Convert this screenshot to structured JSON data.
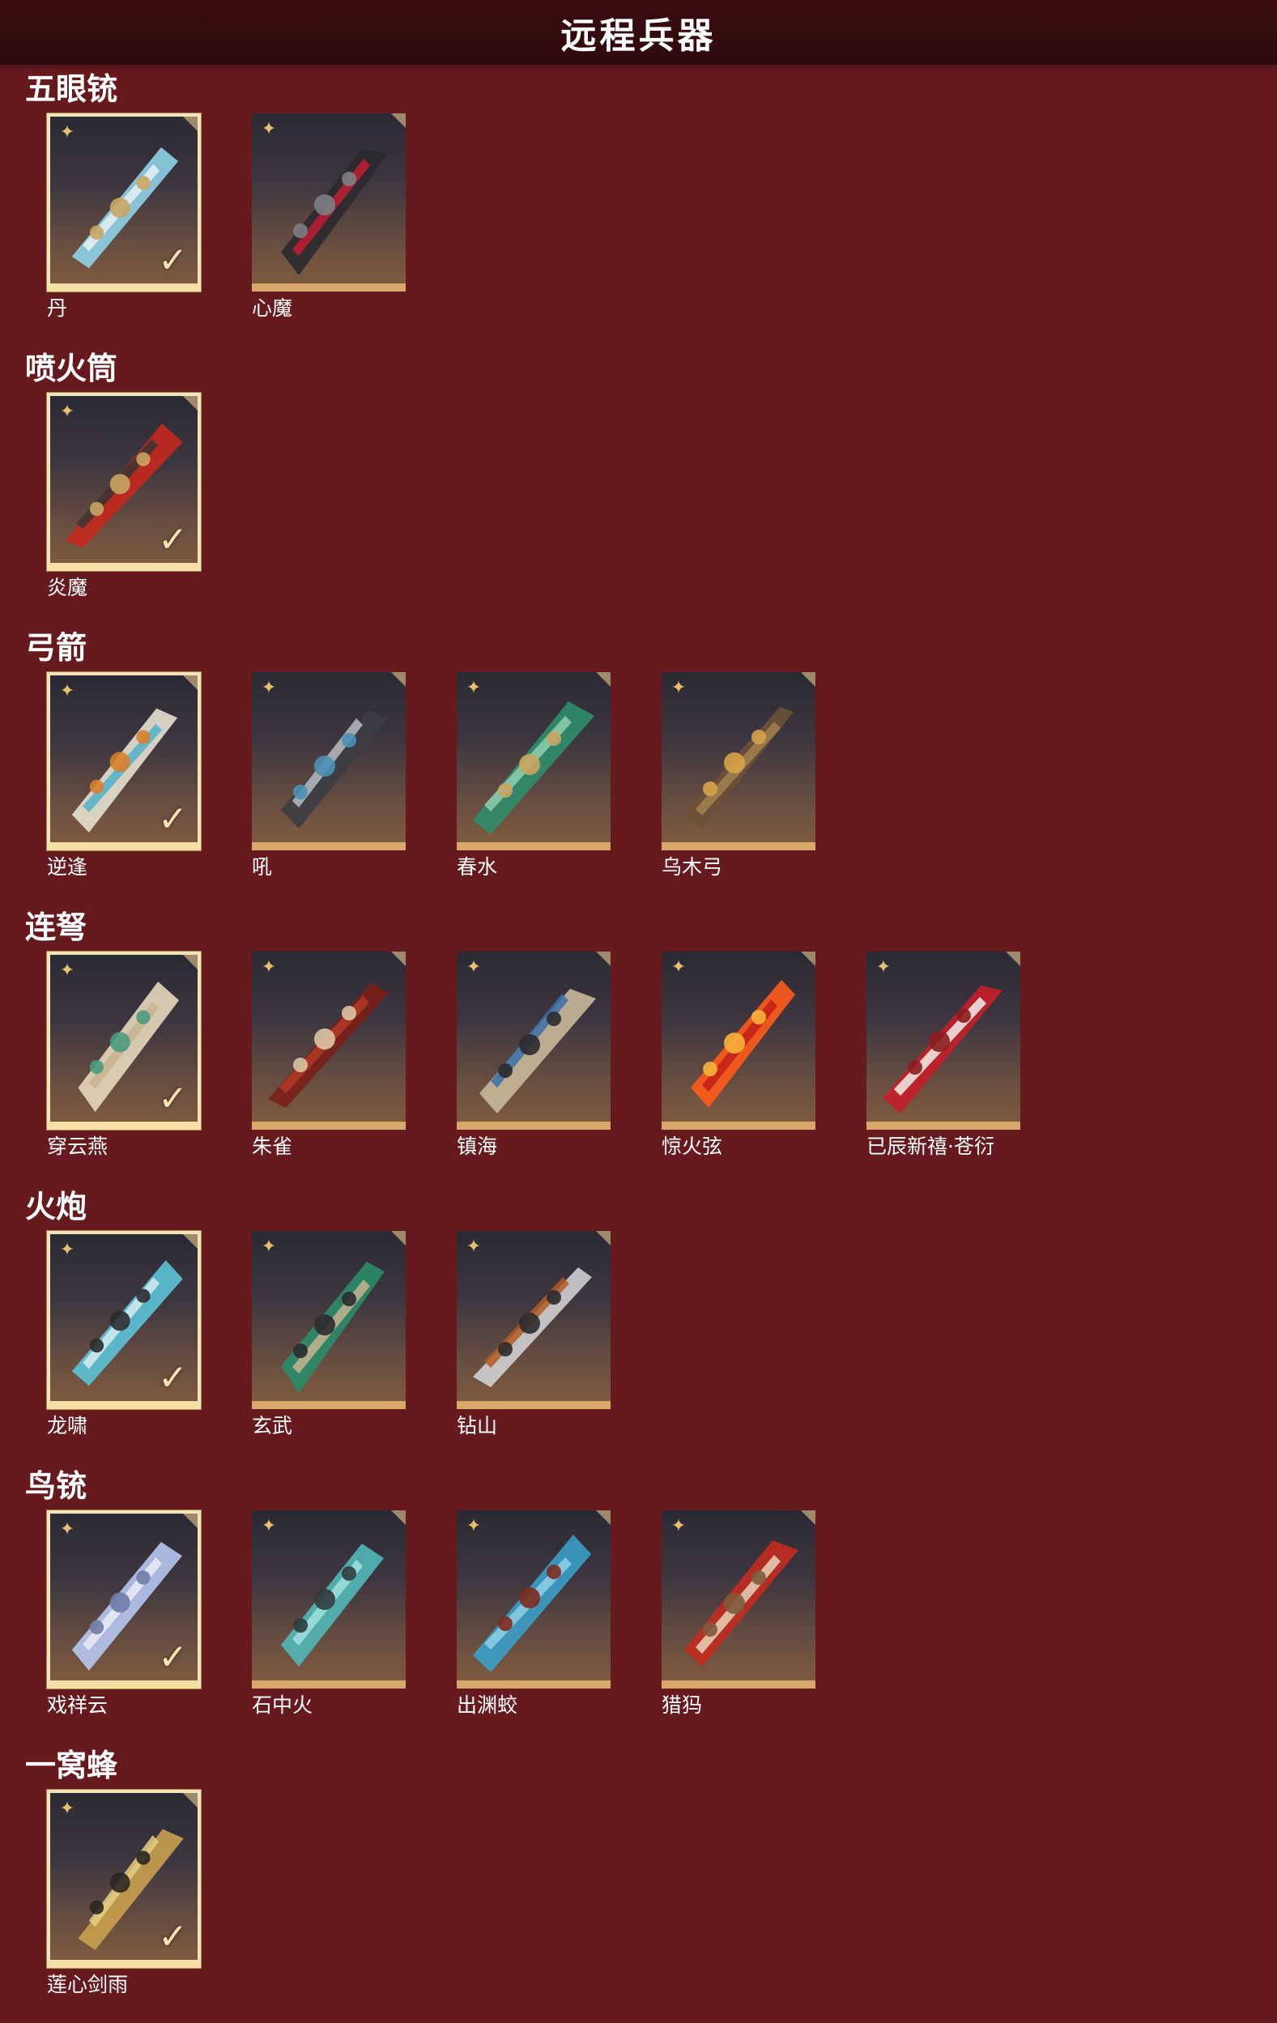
{
  "title": "远程兵器",
  "colors": {
    "background": "#671a1e",
    "header": "#2e0a0c",
    "owned_border": "#f3e3b8",
    "card_bottom": "#d8a86a"
  },
  "sections": [
    {
      "title": "五眼铳",
      "items": [
        {
          "label": "丹",
          "owned": true,
          "palette": [
            "#8fd1e8",
            "#e6f1f3",
            "#c9a562"
          ]
        },
        {
          "label": "心魔",
          "owned": false,
          "palette": [
            "#2a2a2e",
            "#c21d34",
            "#7b7f85"
          ]
        }
      ]
    },
    {
      "title": "喷火筒",
      "items": [
        {
          "label": "炎魔",
          "owned": true,
          "palette": [
            "#c4281e",
            "#3a3532",
            "#c9a562"
          ]
        }
      ]
    },
    {
      "title": "弓箭",
      "items": [
        {
          "label": "逆逢",
          "owned": true,
          "palette": [
            "#e6e1d0",
            "#4fb2c9",
            "#d97f2b"
          ]
        },
        {
          "label": "吼",
          "owned": false,
          "palette": [
            "#3c3d42",
            "#b9bcc2",
            "#4d8fb5"
          ]
        },
        {
          "label": "春水",
          "owned": false,
          "palette": [
            "#2f8d6b",
            "#8ecfae",
            "#c9a562"
          ]
        },
        {
          "label": "乌木弓",
          "owned": false,
          "palette": [
            "#6b5138",
            "#a2814f",
            "#d7a24a"
          ]
        }
      ]
    },
    {
      "title": "连弩",
      "items": [
        {
          "label": "穿云燕",
          "owned": true,
          "palette": [
            "#e5d8bd",
            "#c9b38e",
            "#4a9a7e"
          ]
        },
        {
          "label": "朱雀",
          "owned": false,
          "palette": [
            "#7a1f18",
            "#b13a23",
            "#d9c4a3"
          ]
        },
        {
          "label": "镇海",
          "owned": false,
          "palette": [
            "#c8b89a",
            "#3b6fa8",
            "#2b2a2a"
          ]
        },
        {
          "label": "惊火弦",
          "owned": false,
          "palette": [
            "#ff5b1a",
            "#c21f17",
            "#f6b33a"
          ]
        },
        {
          "label": "已辰新禧·苍衍",
          "owned": false,
          "palette": [
            "#c41f2a",
            "#f1efe9",
            "#8a1c1f"
          ]
        }
      ]
    },
    {
      "title": "火炮",
      "items": [
        {
          "label": "龙啸",
          "owned": true,
          "palette": [
            "#5bc3d6",
            "#d6ecef",
            "#2b2b2d"
          ]
        },
        {
          "label": "玄武",
          "owned": false,
          "palette": [
            "#2a8c6a",
            "#c7b48f",
            "#2b2b2d"
          ]
        },
        {
          "label": "钻山",
          "owned": false,
          "palette": [
            "#cfcfd2",
            "#b05a24",
            "#2b2b2d"
          ]
        }
      ]
    },
    {
      "title": "鸟铳",
      "items": [
        {
          "label": "戏祥云",
          "owned": true,
          "palette": [
            "#b7c6ef",
            "#e9ecf5",
            "#6e7aa6"
          ]
        },
        {
          "label": "石中火",
          "owned": false,
          "palette": [
            "#52b8b7",
            "#9fe1de",
            "#2f3a3e"
          ]
        },
        {
          "label": "出渊蛟",
          "owned": false,
          "palette": [
            "#3a9fc7",
            "#8fd0e5",
            "#7b2a1e"
          ]
        },
        {
          "label": "猎犸",
          "owned": false,
          "palette": [
            "#c22b1f",
            "#e5d3b8",
            "#7e5b3a"
          ]
        }
      ]
    },
    {
      "title": "一窝蜂",
      "items": [
        {
          "label": "莲心剑雨",
          "owned": true,
          "palette": [
            "#c9a04f",
            "#e6cf86",
            "#2a2621"
          ]
        }
      ]
    }
  ]
}
